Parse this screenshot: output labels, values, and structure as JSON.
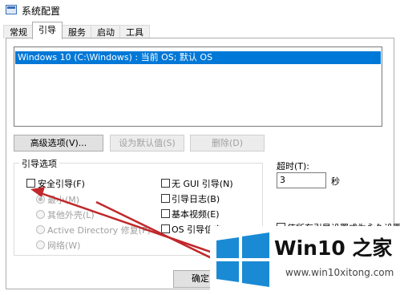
{
  "window": {
    "title": "系统配置"
  },
  "tabs": [
    {
      "label": "常规"
    },
    {
      "label": "引导"
    },
    {
      "label": "服务"
    },
    {
      "label": "启动"
    },
    {
      "label": "工具"
    }
  ],
  "os_list": {
    "items": [
      {
        "label": "Windows 10 (C:\\Windows) : 当前 OS; 默认 OS"
      }
    ]
  },
  "buttons": {
    "advanced": "高级选项(V)...",
    "set_default": "设为默认值(S)",
    "delete": "删除(D)",
    "ok": "确定"
  },
  "boot_options": {
    "legend": "引导选项",
    "safe_boot": {
      "label": "安全引导(F)",
      "checked": false
    },
    "radios": [
      {
        "label": "最小(M)",
        "checked": true
      },
      {
        "label": "其他外壳(L)",
        "checked": false
      },
      {
        "label": "Active Directory 修复(P)",
        "checked": false
      },
      {
        "label": "网络(W)",
        "checked": false
      }
    ],
    "no_gui": "无 GUI 引导(N)",
    "boot_log": "引导日志(B)",
    "base_video": "基本视频(E)",
    "os_info": "OS 引导信息(O)"
  },
  "timeout": {
    "label": "超时(T):",
    "value": "3",
    "unit": "秒"
  },
  "permanent": {
    "label": "使所有引导设置成为永久设置"
  },
  "watermark": {
    "brand": "Win10 之家",
    "url": "www.win10xitong.com"
  },
  "colors": {
    "accent": "#0078d7",
    "arrow": "#c0282b"
  }
}
